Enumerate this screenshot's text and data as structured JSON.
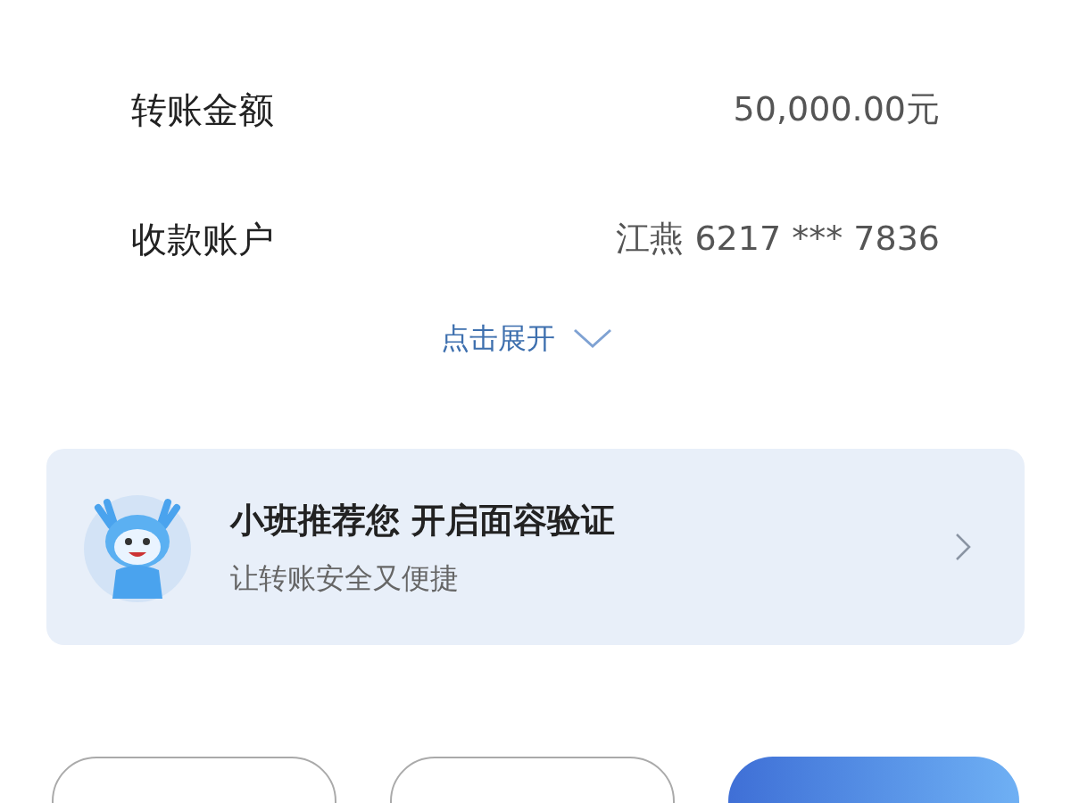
{
  "details": [
    {
      "label": "转账金额",
      "value": "50,000.00元"
    },
    {
      "label": "收款账户",
      "value": "江燕 6217 *** 7836"
    }
  ],
  "expand_link": {
    "label": "点击展开"
  },
  "promo_card": {
    "title": "小班推荐您 开启面容验证",
    "subtitle": "让转账安全又便捷"
  },
  "buttons": [
    {
      "kind": "outline"
    },
    {
      "kind": "outline"
    },
    {
      "kind": "primary"
    }
  ]
}
